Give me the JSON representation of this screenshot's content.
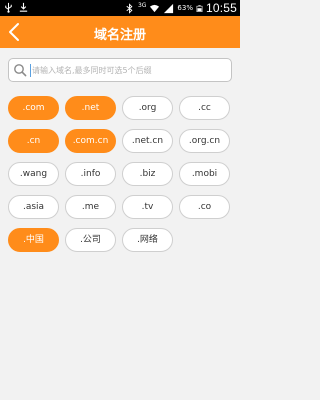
{
  "status_bar": {
    "network": "3G",
    "battery": "63%",
    "time": "10:55",
    "icons": [
      "usb-icon",
      "download-icon",
      "bluetooth-icon",
      "wifi-icon",
      "signal-icon",
      "battery-icon"
    ]
  },
  "header": {
    "title": "域名注册",
    "back_icon": "back-arrow-icon",
    "color": "#ff8c1a"
  },
  "search": {
    "placeholder": "请输入域名,最多同时可选5个后缀",
    "value": "",
    "icon": "search-icon"
  },
  "domains": [
    {
      "label": ".com",
      "selected": true
    },
    {
      "label": ".net",
      "selected": true
    },
    {
      "label": ".org",
      "selected": false
    },
    {
      "label": ".cc",
      "selected": false
    },
    {
      "label": ".cn",
      "selected": true
    },
    {
      "label": ".com.cn",
      "selected": true
    },
    {
      "label": ".net.cn",
      "selected": false
    },
    {
      "label": ".org.cn",
      "selected": false
    },
    {
      "label": ".wang",
      "selected": false
    },
    {
      "label": ".info",
      "selected": false
    },
    {
      "label": ".biz",
      "selected": false
    },
    {
      "label": ".mobi",
      "selected": false
    },
    {
      "label": ".asia",
      "selected": false
    },
    {
      "label": ".me",
      "selected": false
    },
    {
      "label": ".tv",
      "selected": false
    },
    {
      "label": ".co",
      "selected": false
    },
    {
      "label": ".中国",
      "selected": true
    },
    {
      "label": ".公司",
      "selected": false
    },
    {
      "label": ".网络",
      "selected": false
    }
  ],
  "colors": {
    "accent": "#ff8c1a",
    "chip_border": "#cfcfcf",
    "background": "#f2f2f2"
  }
}
